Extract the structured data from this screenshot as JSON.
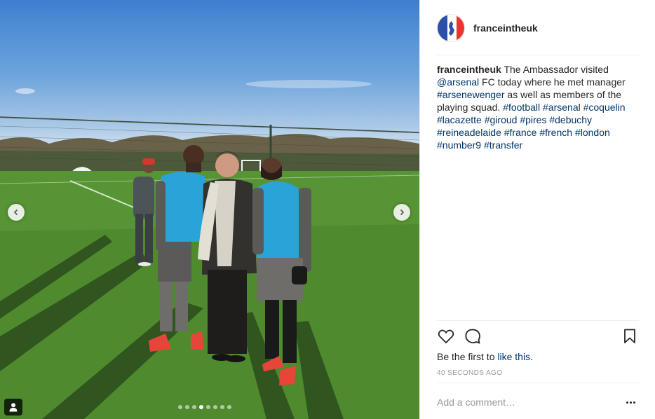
{
  "post": {
    "username": "franceintheuk",
    "caption": {
      "username": "franceintheuk",
      "segments": [
        {
          "text": " The Ambassador visited ",
          "type": "text"
        },
        {
          "text": "@arsenal",
          "type": "mention"
        },
        {
          "text": " FC today where he met manager ",
          "type": "text"
        },
        {
          "text": "#arsenewenger",
          "type": "hashtag"
        },
        {
          "text": " as well as members of the playing squad. ",
          "type": "text"
        },
        {
          "text": "#football",
          "type": "hashtag"
        },
        {
          "text": " ",
          "type": "text"
        },
        {
          "text": "#arsenal",
          "type": "hashtag"
        },
        {
          "text": " ",
          "type": "text"
        },
        {
          "text": "#coquelin",
          "type": "hashtag"
        },
        {
          "text": " ",
          "type": "text"
        },
        {
          "text": "#lacazette",
          "type": "hashtag"
        },
        {
          "text": " ",
          "type": "text"
        },
        {
          "text": "#giroud",
          "type": "hashtag"
        },
        {
          "text": " ",
          "type": "text"
        },
        {
          "text": "#pires",
          "type": "hashtag"
        },
        {
          "text": " ",
          "type": "text"
        },
        {
          "text": "#debuchy",
          "type": "hashtag"
        },
        {
          "text": " ",
          "type": "text"
        },
        {
          "text": "#reineadelaide",
          "type": "hashtag"
        },
        {
          "text": " ",
          "type": "text"
        },
        {
          "text": "#france",
          "type": "hashtag"
        },
        {
          "text": " ",
          "type": "text"
        },
        {
          "text": "#french",
          "type": "hashtag"
        },
        {
          "text": " ",
          "type": "text"
        },
        {
          "text": "#london",
          "type": "hashtag"
        },
        {
          "text": " ",
          "type": "text"
        },
        {
          "text": "#number9",
          "type": "hashtag"
        },
        {
          "text": " ",
          "type": "text"
        },
        {
          "text": "#transfer",
          "type": "hashtag"
        }
      ]
    },
    "likes": {
      "prefix": "Be the first to ",
      "link": "like this",
      "suffix": "."
    },
    "timestamp": "40 SECONDS AGO",
    "comment_placeholder": "Add a comment…"
  },
  "carousel": {
    "count": 8,
    "active_index": 3
  },
  "icons": {
    "avatar": "france-uk-flag-icon",
    "prev": "chevron-left-icon",
    "next": "chevron-right-icon",
    "like": "heart-icon",
    "comment": "comment-bubble-icon",
    "save": "bookmark-icon",
    "more": "more-options-icon",
    "tagged": "user-tag-icon"
  },
  "colors": {
    "link": "#003569",
    "text": "#262626",
    "muted": "#999999"
  }
}
